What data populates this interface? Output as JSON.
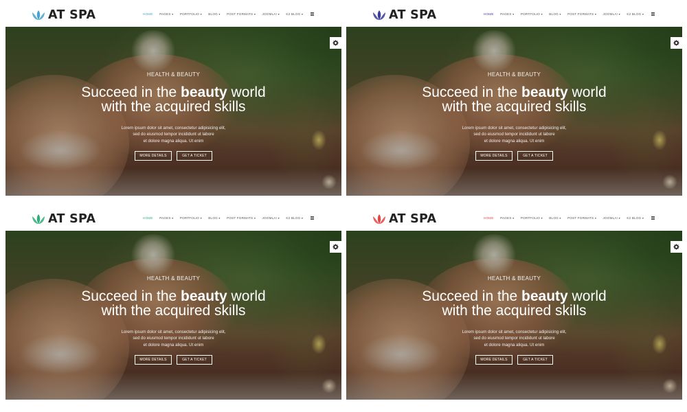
{
  "brand": {
    "name": "AT SPA"
  },
  "nav": {
    "items": [
      {
        "label": "HOME",
        "caret": false
      },
      {
        "label": "PAGES",
        "caret": true
      },
      {
        "label": "PORTFOLIO",
        "caret": true
      },
      {
        "label": "BLOG",
        "caret": true
      },
      {
        "label": "POST FORMATS",
        "caret": true
      },
      {
        "label": "JOOMLA!",
        "caret": true
      },
      {
        "label": "K2 BLOG",
        "caret": true
      }
    ],
    "menu_icon": "hamburger-icon"
  },
  "hero": {
    "eyebrow": "HEALTH & BEAUTY",
    "headline_part1": "Succeed in the ",
    "headline_bold": "beauty",
    "headline_part2": " world",
    "headline_line2": "with the acquired skills",
    "lede_line1": "Lorem ipsum dolor sit amet, consectetur adipisicing elit,",
    "lede_line2": "sed do eiusmod tempor incididunt ut labore",
    "lede_line3": "et dolore magna aliqua. Ut enim",
    "button_more": "MORE DETAILS",
    "button_ticket": "GET A TICKET",
    "settings_icon": "gear-icon"
  },
  "variants": [
    {
      "accent": "#4aa3c8"
    },
    {
      "accent": "#3a3a9a"
    },
    {
      "accent": "#2fae7a"
    },
    {
      "accent": "#e04848"
    }
  ]
}
